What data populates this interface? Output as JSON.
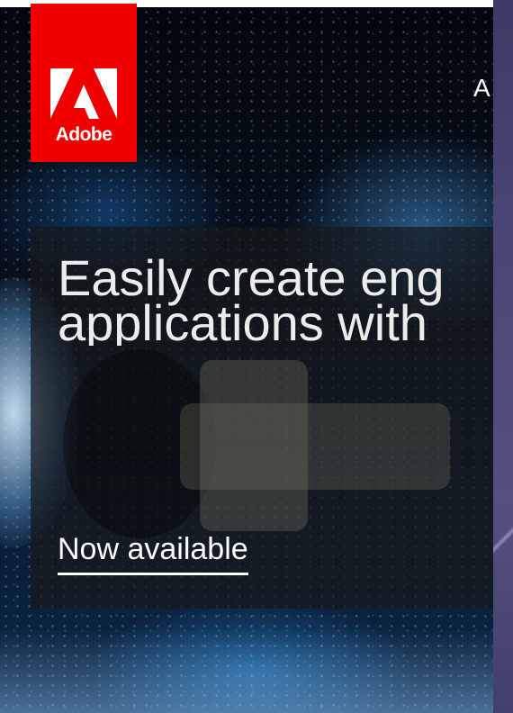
{
  "brand": {
    "wordmark": "Adobe",
    "color": "#f00000"
  },
  "nav": {
    "label": "A"
  },
  "hero": {
    "headline_line1": "Easily create eng",
    "headline_line2": "applications with",
    "cta_label": "Now available"
  },
  "colors": {
    "panel": "#16181b",
    "side_strip": "#4a4676"
  }
}
